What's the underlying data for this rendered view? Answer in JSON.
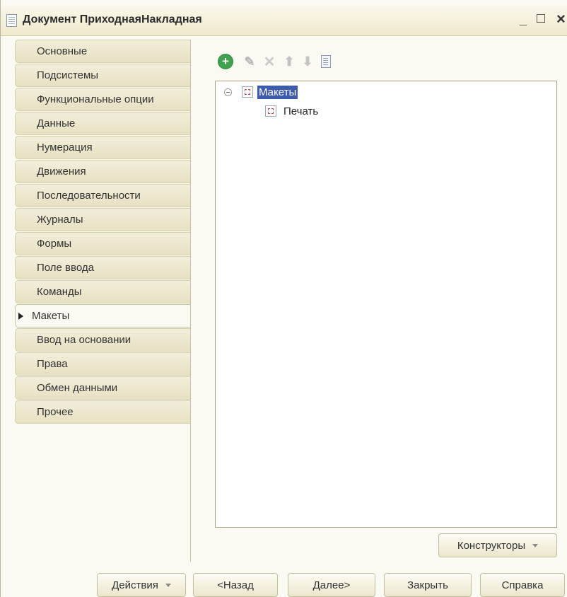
{
  "window": {
    "title": "Документ ПриходнаяНакладная",
    "minimize_glyph": "_",
    "maximize_glyph": "□",
    "close_glyph": "×"
  },
  "tabs": [
    {
      "label": "Основные",
      "active": false
    },
    {
      "label": "Подсистемы",
      "active": false
    },
    {
      "label": "Функциональные опции",
      "active": false
    },
    {
      "label": "Данные",
      "active": false
    },
    {
      "label": "Нумерация",
      "active": false
    },
    {
      "label": "Движения",
      "active": false
    },
    {
      "label": "Последовательности",
      "active": false
    },
    {
      "label": "Журналы",
      "active": false
    },
    {
      "label": "Формы",
      "active": false
    },
    {
      "label": "Поле ввода",
      "active": false
    },
    {
      "label": "Команды",
      "active": false
    },
    {
      "label": "Макеты",
      "active": true
    },
    {
      "label": "Ввод на основании",
      "active": false
    },
    {
      "label": "Права",
      "active": false
    },
    {
      "label": "Обмен данными",
      "active": false
    },
    {
      "label": "Прочее",
      "active": false
    }
  ],
  "toolbar": {
    "icons": [
      "add-icon",
      "edit-icon",
      "delete-icon",
      "move-up-icon",
      "move-down-icon",
      "list-icon"
    ],
    "accent": "#3fa34d"
  },
  "tree": {
    "root_label": "Макеты",
    "child_label": "Печать",
    "selection_color": "#3d5bb0"
  },
  "buttons": {
    "constructors": "Конструкторы",
    "actions": "Действия",
    "back": "<Назад",
    "next": "Далее>",
    "close": "Закрыть",
    "help": "Справка"
  }
}
